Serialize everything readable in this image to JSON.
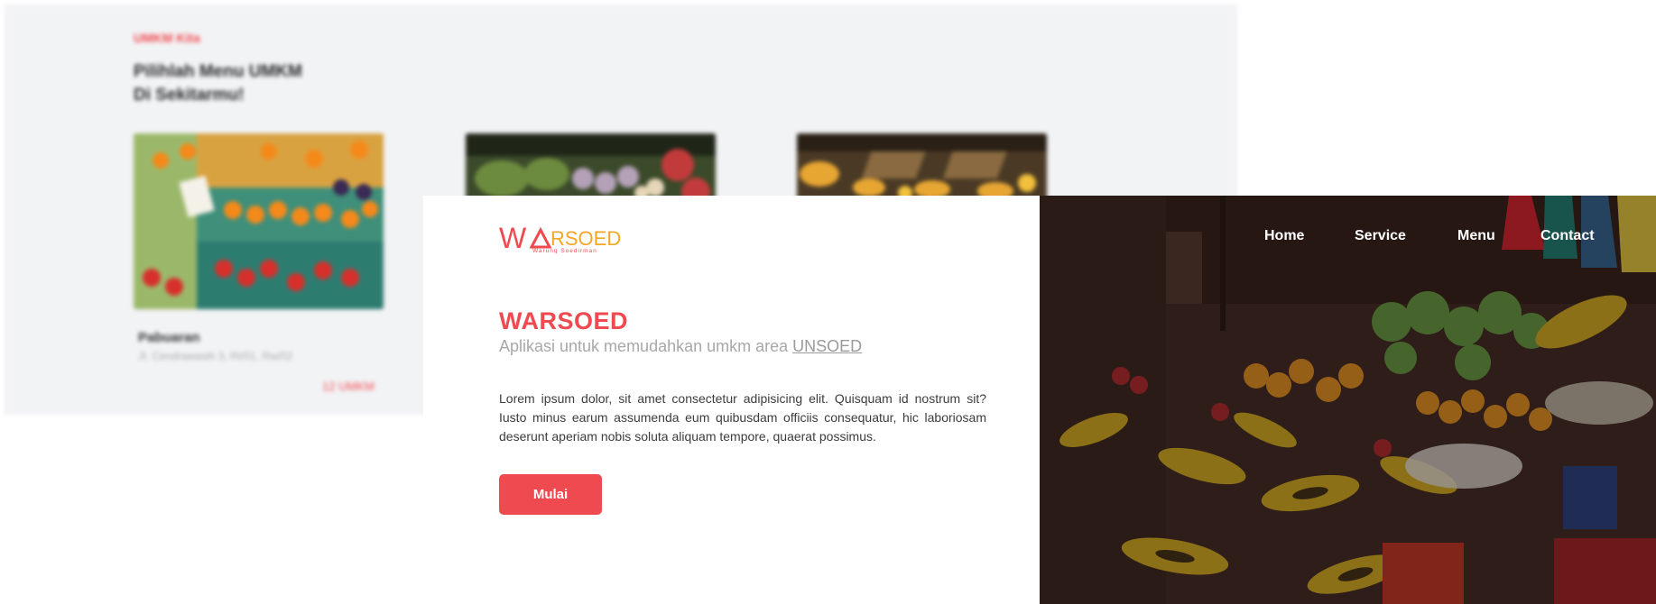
{
  "background_page": {
    "eyebrow": "UMKM Kita",
    "heading_line1": "Pilihlah Menu UMKM",
    "heading_line2": "Di Sekitarmu!",
    "card": {
      "name": "Pabuaran",
      "address": "Jl. Cendrawasih 3, Rt/01, Rw/02",
      "count": "12 UMKM"
    }
  },
  "hero": {
    "logo_text": "WARSOED",
    "logo_tagline": "Warung Soedirman",
    "title": "WARSOED",
    "subtitle_prefix": "Aplikasi untuk memudahkan umkm area ",
    "subtitle_link": "UNSOED",
    "description": "Lorem ipsum dolor, sit amet consectetur adipisicing elit. Quisquam id nostrum sit? Iusto minus earum assumenda eum quibusdam officiis consequatur, hic laboriosam deserunt aperiam nobis soluta aliquam tempore, quaerat possimus.",
    "cta_label": "Mulai"
  },
  "nav": {
    "items": [
      "Home",
      "Service",
      "Menu",
      "Contact"
    ]
  },
  "colors": {
    "accent": "#f04a51",
    "logo_orange": "#f6a623",
    "bg_gray": "#f2f3f5"
  }
}
